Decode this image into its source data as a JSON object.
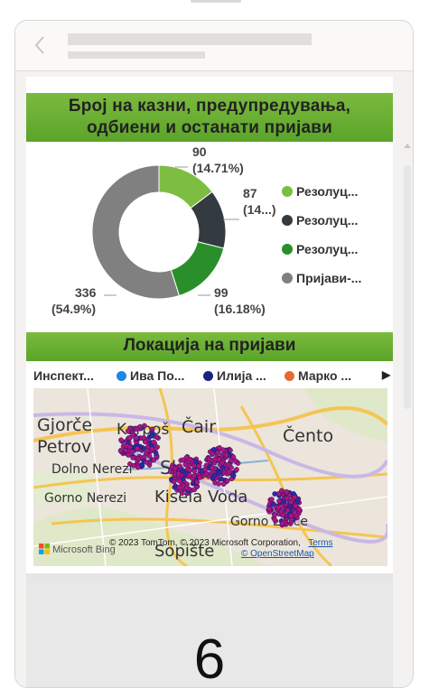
{
  "donut_card": {
    "title_line1": "Број на казни, предупредувања,",
    "title_line2": "одбиени и останати пријави",
    "chart_data": {
      "type": "pie",
      "series": [
        {
          "name": "Резолуц...",
          "value": 90,
          "label_value": "90",
          "label_pct": "(14.71%)",
          "color": "#7dbd42"
        },
        {
          "name": "Резолуц...",
          "value": 87,
          "label_value": "87",
          "label_pct": "(14...)",
          "color": "#333a40"
        },
        {
          "name": "Резолуц...",
          "value": 99,
          "label_value": "99",
          "label_pct": "(16.18%)",
          "color": "#2a8f2a"
        },
        {
          "name": "Пријави-...",
          "value": 336,
          "label_value": "336",
          "label_pct": "(54.9%)",
          "color": "#808080"
        }
      ],
      "legend_position": "right"
    }
  },
  "map_card": {
    "title": "Локација на пријави",
    "legend": [
      {
        "label": "Инспект...",
        "color": ""
      },
      {
        "label": "Ива По...",
        "color": "#1e88e5"
      },
      {
        "label": "Илија ...",
        "color": "#1a237e"
      },
      {
        "label": "Марко ...",
        "color": "#e8692f"
      }
    ],
    "places": [
      "Gjorče",
      "Petrov",
      "Karpoš",
      "Čair",
      "Čento",
      "Dolno Nerezi",
      "Sk",
      "Gorno Nerezi",
      "Kisela Voda",
      "Gorno Lisiče",
      "Sopište"
    ],
    "bing_label": "Microsoft Bing",
    "attribution": "© 2023 TomTom, © 2023 Microsoft Corporation,",
    "terms": "Terms",
    "osm": "© OpenStreetMap"
  },
  "kpi_card": {
    "value": "6"
  },
  "icons": {
    "back": "chevron-left-icon",
    "legend_next": "caret-right-icon"
  }
}
